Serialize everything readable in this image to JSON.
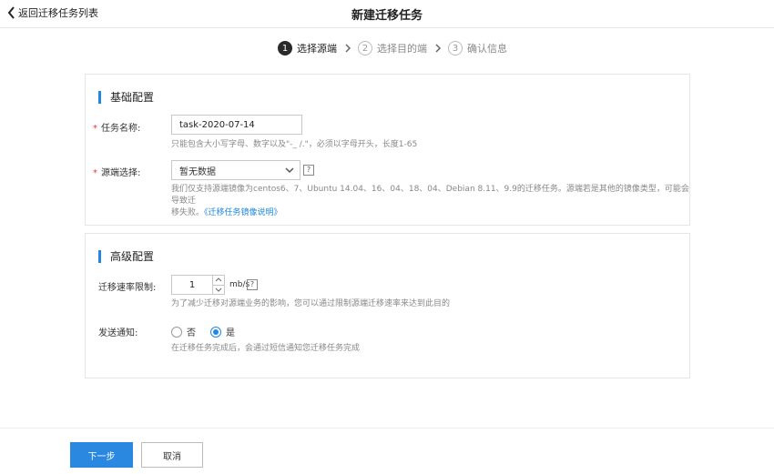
{
  "header": {
    "back_label": "返回迁移任务列表",
    "title": "新建迁移任务"
  },
  "steps": [
    {
      "num": "1",
      "label": "选择源端",
      "active": true
    },
    {
      "num": "2",
      "label": "选择目的端",
      "active": false
    },
    {
      "num": "3",
      "label": "确认信息",
      "active": false
    }
  ],
  "basic": {
    "title": "基础配置",
    "task_name": {
      "label": "任务名称:",
      "value": "task-2020-07-14",
      "hint": "只能包含大小写字母、数字以及\"-_ /.\"，必须以字母开头，长度1-65"
    },
    "source": {
      "label": "源端选择:",
      "selected": "暂无数据",
      "help": "?",
      "hint_line1": "我们仅支持源端镜像为centos6、7、Ubuntu 14.04、16、04、18、04、Debian 8.11、9.9的迁移任务。源端若是其他的镜像类型，可能会导致迁",
      "hint_line2": "移失败。",
      "hint_link": "《迁移任务镜像说明》"
    }
  },
  "advanced": {
    "title": "高级配置",
    "rate": {
      "label": "迁移速率限制:",
      "value": "1",
      "unit": "mb/s",
      "help": "?",
      "hint": "为了减少迁移对源端业务的影响，您可以通过限制源端迁移速率来达到此目的"
    },
    "notify": {
      "label": "发送通知:",
      "option_no": "否",
      "option_yes": "是",
      "selected": "是",
      "hint": "在迁移任务完成后，会通过短信通知您迁移任务完成"
    }
  },
  "footer": {
    "next_label": "下一步",
    "cancel_label": "取消"
  },
  "colors": {
    "accent": "#1e88e5",
    "primary_button": "#2b88e0",
    "required": "#e53935"
  }
}
